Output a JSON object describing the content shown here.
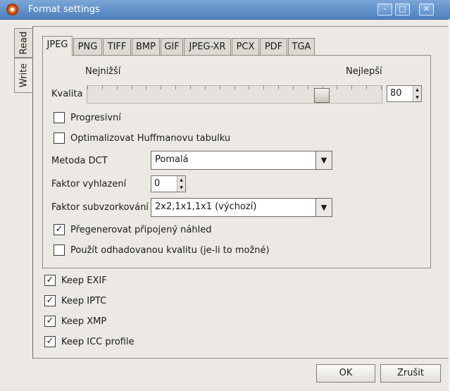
{
  "window": {
    "title": "Format settings",
    "buttons": [
      "–",
      "□",
      "✕"
    ]
  },
  "side_tabs": [
    {
      "label": "Read",
      "active": false
    },
    {
      "label": "Write",
      "active": true
    }
  ],
  "format_tabs": [
    "JPEG",
    "PNG",
    "TIFF",
    "BMP",
    "GIF",
    "JPEG-XR",
    "PCX",
    "PDF",
    "TGA"
  ],
  "active_format_tab": "JPEG",
  "jpeg": {
    "quality_min_label": "Nejnižší",
    "quality_max_label": "Nejlepší",
    "quality_label": "Kvalita",
    "quality_value": "80",
    "quality_fraction": 0.8,
    "progressive_label": "Progresivní",
    "progressive_checked": false,
    "huffman_label": "Optimalizovat Huffmanovu tabulku",
    "huffman_checked": false,
    "dct_label": "Metoda DCT",
    "dct_value": "Pomalá",
    "smoothing_label": "Faktor vyhlazení",
    "smoothing_value": "0",
    "subsampling_label": "Faktor subvzorkování",
    "subsampling_value": "2x2,1x1,1x1 (výchozí)",
    "regen_thumb_label": "Přegenerovat připojený náhled",
    "regen_thumb_checked": true,
    "estimated_quality_label": "Použít odhadovanou kvalitu (je-li to možné)",
    "estimated_quality_checked": false
  },
  "keep_options": [
    {
      "label": "Keep EXIF",
      "checked": true
    },
    {
      "label": "Keep IPTC",
      "checked": true
    },
    {
      "label": "Keep XMP",
      "checked": true
    },
    {
      "label": "Keep ICC profile",
      "checked": true
    }
  ],
  "buttons": {
    "ok": "OK",
    "cancel": "Zrušit"
  },
  "icons": {
    "app": "app-icon",
    "check": "checkmark-icon",
    "dropdown": "chevron-down-icon",
    "spin_up": "arrow-up-icon",
    "spin_down": "arrow-down-icon"
  }
}
